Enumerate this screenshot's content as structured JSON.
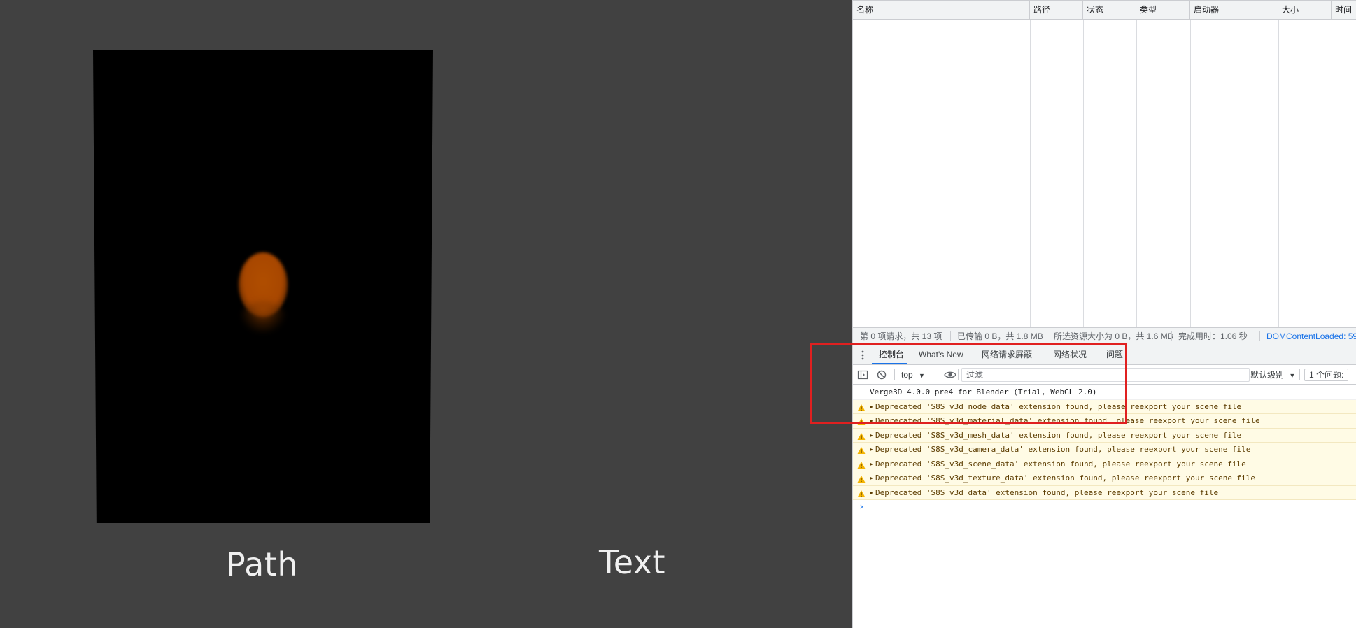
{
  "scene": {
    "label_path": "Path",
    "label_text": "Text",
    "orb_color": "#b04e00"
  },
  "network": {
    "columns": [
      "名称",
      "路径",
      "状态",
      "类型",
      "启动器",
      "大小",
      "时间"
    ],
    "summary": {
      "requests": "第 0 项请求，共 13 项",
      "transferred": "已传输 0 B，共 1.8 MB",
      "resources": "所选资源大小为 0 B，共 1.6 MB",
      "finish": "完成用时：1.06 秒",
      "dom_content_loaded": "DOMContentLoaded: 59"
    }
  },
  "drawer": {
    "tabs": [
      "控制台",
      "What's New",
      "网络请求屏蔽",
      "网络状况",
      "问题"
    ],
    "active_tab": "控制台"
  },
  "console_toolbar": {
    "context": "top",
    "filter_placeholder": "过滤",
    "levels": "默认级别",
    "issues": "1 个问题:"
  },
  "console": {
    "info_message": "Verge3D 4.0.0 pre4 for Blender (Trial, WebGL 2.0)",
    "warnings": [
      "Deprecated 'S8S_v3d_node_data' extension found, please reexport your scene file",
      "Deprecated 'S8S_v3d_material_data' extension found, please reexport your scene file",
      "Deprecated 'S8S_v3d_mesh_data' extension found, please reexport your scene file",
      "Deprecated 'S8S_v3d_camera_data' extension found, please reexport your scene file",
      "Deprecated 'S8S_v3d_scene_data' extension found, please reexport your scene file",
      "Deprecated 'S8S_v3d_texture_data' extension found, please reexport your scene file",
      "Deprecated 'S8S_v3d_data' extension found, please reexport your scene file"
    ],
    "prompt": "›"
  },
  "colors": {
    "accent": "#1a73e8",
    "warning_bg": "#fffbe5",
    "warning_icon": "#f4b400",
    "highlight": "#e02020"
  }
}
